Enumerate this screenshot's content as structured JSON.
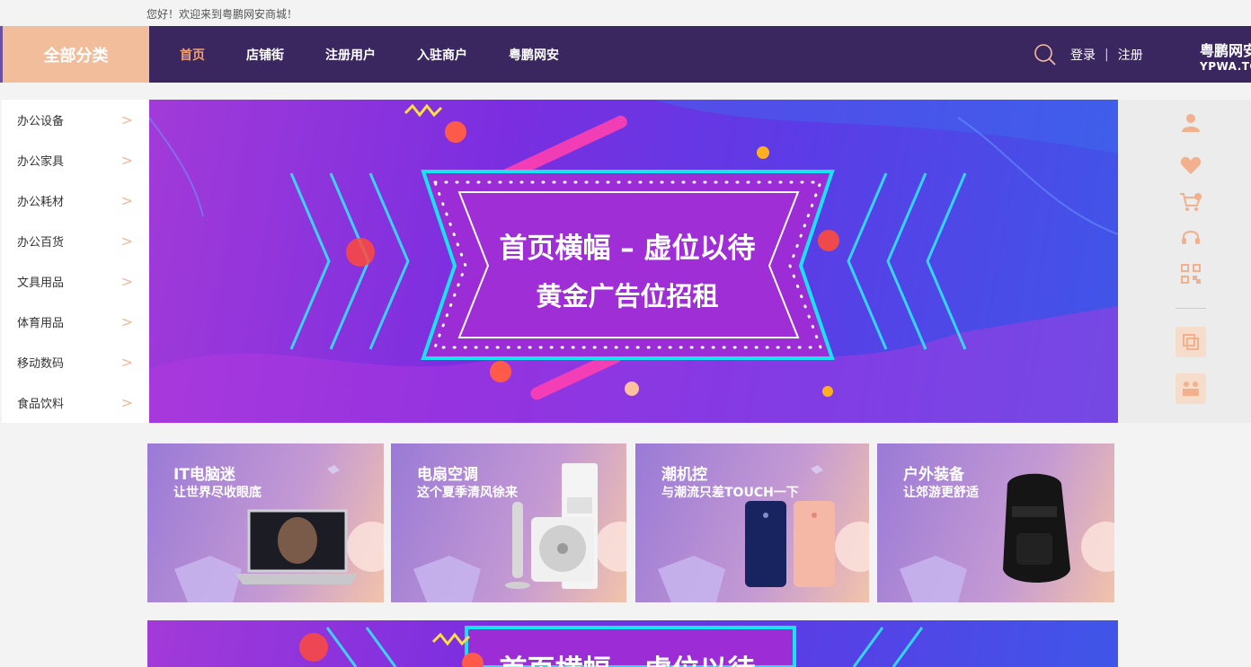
{
  "topbar": {
    "welcome": "您好！欢迎来到粤鹏网安商城！"
  },
  "nav": {
    "all_categories": "全部分类",
    "links": [
      {
        "label": "首页",
        "active": true
      },
      {
        "label": "店铺街",
        "active": false
      },
      {
        "label": "注册用户",
        "active": false
      },
      {
        "label": "入驻商户",
        "active": false
      },
      {
        "label": "粤鹏网安",
        "active": false
      }
    ],
    "login": "登录",
    "separator": "|",
    "register": "注册",
    "brand_cn": "粤鹏网安",
    "brand_en": "YPWA.TOP"
  },
  "sidebar": {
    "items": [
      {
        "label": "办公设备"
      },
      {
        "label": "办公家具"
      },
      {
        "label": "办公耗材"
      },
      {
        "label": "办公百货"
      },
      {
        "label": "文具用品"
      },
      {
        "label": "体育用品"
      },
      {
        "label": "移动数码"
      },
      {
        "label": "食品饮料"
      }
    ]
  },
  "banner": {
    "line1": "首页横幅 – 虚位以待",
    "line2": "黄金广告位招租"
  },
  "rightbar": {
    "icons": [
      "user-icon",
      "heart-icon",
      "cart-icon",
      "headset-icon",
      "qrcode-icon",
      "copy-icon",
      "people-icon"
    ]
  },
  "promos": [
    {
      "title": "IT电脑迷",
      "subtitle": "让世界尽收眼底"
    },
    {
      "title": "电扇空调",
      "subtitle": "这个夏季清风徐来"
    },
    {
      "title": "潮机控",
      "subtitle": "与潮流只差TOUCH一下"
    },
    {
      "title": "户外装备",
      "subtitle": "让郊游更舒适"
    }
  ],
  "banner2": {
    "line1": "首页横幅 – 虚位以待"
  },
  "colors": {
    "nav_bg": "#3a2760",
    "accent_peach": "#f2bd9b",
    "active_link": "#f2a070",
    "banner_purple": "#7b2ee0",
    "cyan_frame": "#19e3f0"
  }
}
